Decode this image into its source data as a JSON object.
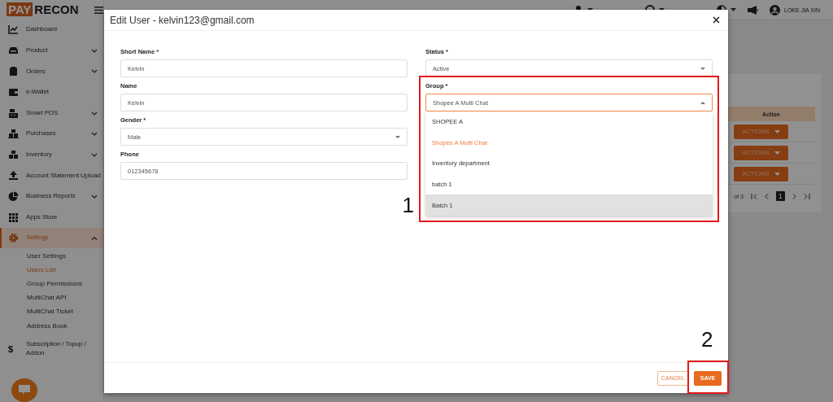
{
  "app": {
    "logo": [
      "PAY",
      "RECON"
    ],
    "user": "LOKE JIA XIN"
  },
  "sidebar": {
    "items": [
      {
        "label": "Dashboard",
        "selected": false
      },
      {
        "label": "Product",
        "expanded": false,
        "selected": false
      },
      {
        "label": "Orders",
        "expanded": false,
        "selected": false
      },
      {
        "label": "e-Wallet",
        "selected": false
      },
      {
        "label": "Smart POS",
        "expanded": false,
        "selected": false
      },
      {
        "label": "Purchases",
        "expanded": false,
        "selected": false
      },
      {
        "label": "Inventory",
        "expanded": false,
        "selected": false
      },
      {
        "label": "Account Statement Upload",
        "selected": false
      },
      {
        "label": "Business Reports",
        "expanded": false,
        "selected": false
      },
      {
        "label": "Apps Store",
        "selected": false
      },
      {
        "label": "Settings",
        "expanded": true,
        "selected": true,
        "children": [
          {
            "label": "User Settings",
            "selected": false
          },
          {
            "label": "Users List",
            "selected": true
          },
          {
            "label": "Group Permissions",
            "selected": false
          },
          {
            "label": "MultiChat API",
            "selected": false
          },
          {
            "label": "MultiChat Ticket",
            "selected": false
          },
          {
            "label": "Address Book",
            "selected": false
          }
        ]
      },
      {
        "label": "Subscription / Topup / Addon",
        "icon_text": "$",
        "selected": false
      }
    ]
  },
  "table": {
    "columns": [
      "Action"
    ],
    "rows": [
      {
        "action": "ACTIONS"
      },
      {
        "action": "ACTIONS"
      },
      {
        "action": "ACTIONS"
      }
    ],
    "pagination": {
      "range": "of 3",
      "page": "1"
    }
  },
  "dialog": {
    "title": "Edit User - kelvin123@gmail.com",
    "columns": [
      [
        {
          "label": "Short Name *",
          "kind": "text",
          "value": "Kelvin"
        },
        {
          "label": "Name",
          "kind": "text",
          "value": "Kelvin"
        },
        {
          "label": "Gender *",
          "kind": "select",
          "value": "Male",
          "open": false
        },
        {
          "label": "Phone",
          "kind": "text",
          "value": "012345678"
        }
      ],
      [
        {
          "label": "Status *",
          "kind": "select",
          "value": "Active",
          "open": false
        },
        {
          "label": "Group *",
          "kind": "select",
          "value": "Shopee A Multi Chat",
          "open": true,
          "annotation": "1",
          "options": [
            {
              "label": "SHOPEE A",
              "selected": false,
              "highlighted": false
            },
            {
              "label": "Shopee A Multi Chat",
              "selected": true,
              "highlighted": false
            },
            {
              "label": "Inventory department",
              "selected": false,
              "highlighted": false
            },
            {
              "label": "batch 1",
              "selected": false,
              "highlighted": false
            },
            {
              "label": "Batch 1",
              "selected": false,
              "highlighted": true
            }
          ]
        }
      ]
    ],
    "buttons": [
      {
        "label": "CANCEL",
        "kind": "outline"
      },
      {
        "label": "SAVE",
        "kind": "primary",
        "annotation": "2"
      }
    ]
  }
}
